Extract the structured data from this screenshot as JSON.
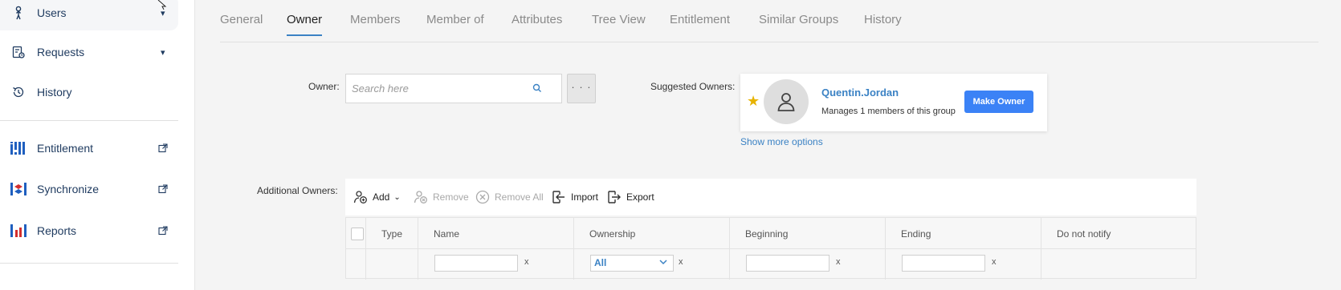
{
  "sidebar": {
    "items": [
      {
        "label": "Users",
        "icon": "user-icon",
        "caret": "▾"
      },
      {
        "label": "Requests",
        "icon": "requests-icon",
        "caret": "▾"
      },
      {
        "label": "History",
        "icon": "history-icon"
      },
      {
        "label": "Entitlement",
        "icon": "entitlement-icon"
      },
      {
        "label": "Synchronize",
        "icon": "synchronize-icon"
      },
      {
        "label": "Reports",
        "icon": "reports-icon"
      }
    ]
  },
  "tabs": [
    "General",
    "Owner",
    "Members",
    "Member of",
    "Attributes",
    "Tree View",
    "Entitlement",
    "Similar Groups",
    "History"
  ],
  "active_tab": "Owner",
  "owner": {
    "label": "Owner:",
    "search_placeholder": "Search here",
    "browse_label": "· · ·"
  },
  "suggested": {
    "label": "Suggested Owners:",
    "name": "Quentin.Jordan",
    "description": "Manages 1 members of this group",
    "make_owner_label": "Make Owner",
    "show_more_label": "Show more options"
  },
  "additional": {
    "label": "Additional Owners:",
    "toolbar": {
      "add": "Add",
      "remove": "Remove",
      "remove_all": "Remove All",
      "import": "Import",
      "export": "Export"
    },
    "columns": {
      "type": "Type",
      "name": "Name",
      "ownership": "Ownership",
      "beginning": "Beginning",
      "ending": "Ending",
      "do_not_notify": "Do not notify"
    },
    "filter": {
      "ownership_value": "All",
      "clear_label": "x"
    }
  },
  "colors": {
    "accent": "#3b82c4",
    "button": "#3b82f6",
    "star": "#e7b300",
    "nav_text": "#1e3a5f"
  }
}
